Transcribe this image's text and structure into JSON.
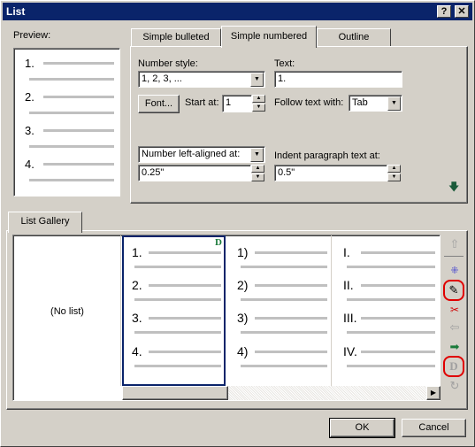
{
  "title": "List",
  "titlebar": {
    "help_label": "?",
    "close_label": "✕"
  },
  "preview": {
    "label": "Preview:",
    "items": [
      "1.",
      "2.",
      "3.",
      "4."
    ]
  },
  "tabs": [
    {
      "label": "Simple bulleted",
      "active": false
    },
    {
      "label": "Simple numbered",
      "active": true
    },
    {
      "label": "Outline",
      "active": false
    }
  ],
  "form": {
    "number_style_label": "Number style:",
    "number_style_value": "1, 2, 3, ...",
    "text_label": "Text:",
    "text_value": "1.",
    "font_button": "Font...",
    "start_at_label": "Start at:",
    "start_at_value": "1",
    "follow_text_label": "Follow text with:",
    "follow_text_value": "Tab",
    "align_value": "Number left-aligned at:",
    "align_measure": "0.25\"",
    "indent_label": "Indent paragraph text at:",
    "indent_value": "0.5\""
  },
  "gallery": {
    "tab_label": "List Gallery",
    "no_list": "(No list)",
    "col1": [
      "1.",
      "2.",
      "3.",
      "4."
    ],
    "col2": [
      "1)",
      "2)",
      "3)",
      "4)"
    ],
    "col3": [
      "I.",
      "II.",
      "III.",
      "IV."
    ],
    "default_badge": "D"
  },
  "toolbar_icons": [
    "move-up-icon",
    "insert-icon",
    "edit-icon",
    "delete-icon",
    "move-left-icon",
    "move-right-icon",
    "default-icon",
    "reset-icon"
  ],
  "buttons": {
    "ok": "OK",
    "cancel": "Cancel"
  },
  "colors": {
    "titlebar": "#0a246a",
    "selection": "#0a246a",
    "green": "#1a7a3a",
    "red_highlight": "#e00000"
  }
}
